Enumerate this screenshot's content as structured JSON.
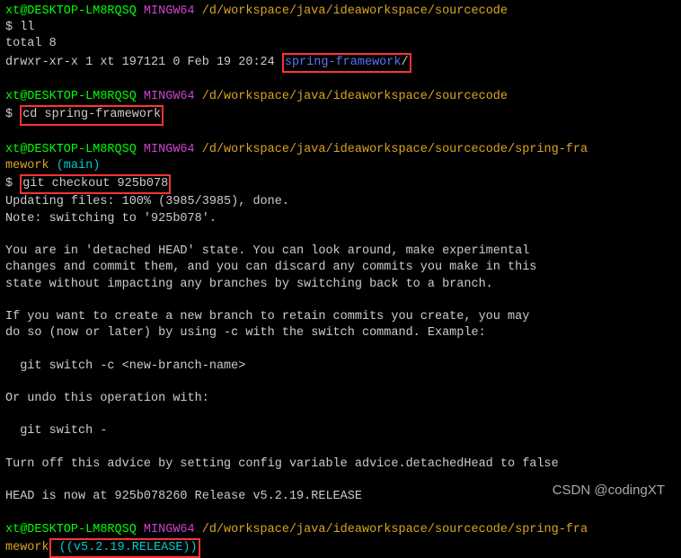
{
  "prompt1": {
    "user": "xt@DESKTOP-LM8RQSQ",
    "mingw": " MINGW64",
    "path": " /d/workspace/java/ideaworkspace/sourcecode"
  },
  "cmd1": "$ ll",
  "out1_l1": "total 8",
  "out1_l2_a": "drwxr-xr-x 1 xt 197121 0 Feb 19 20:24 ",
  "out1_l2_b": "spring-framework",
  "out1_l2_c": "/",
  "prompt2": {
    "user": "xt@DESKTOP-LM8RQSQ",
    "mingw": " MINGW64",
    "path": " /d/workspace/java/ideaworkspace/sourcecode"
  },
  "cmd2_prefix": "$ ",
  "cmd2": "cd spring-framework",
  "prompt3": {
    "user": "xt@DESKTOP-LM8RQSQ",
    "mingw": " MINGW64",
    "path": " /d/workspace/java/ideaworkspace/sourcecode/spring-fra",
    "path2": "mework",
    "branch": " (main)"
  },
  "cmd3_prefix": "$ ",
  "cmd3": "git checkout 925b078",
  "out3_l1": "Updating files: 100% (3985/3985), done.",
  "out3_l2": "Note: switching to '925b078'.",
  "out3_l3": "You are in 'detached HEAD' state. You can look around, make experimental",
  "out3_l4": "changes and commit them, and you can discard any commits you make in this",
  "out3_l5": "state without impacting any branches by switching back to a branch.",
  "out3_l6": "If you want to create a new branch to retain commits you create, you may",
  "out3_l7": "do so (now or later) by using -c with the switch command. Example:",
  "out3_l8": "  git switch -c <new-branch-name>",
  "out3_l9": "Or undo this operation with:",
  "out3_l10": "  git switch -",
  "out3_l11": "Turn off this advice by setting config variable advice.detachedHead to false",
  "out3_l12": "HEAD is now at 925b078260 Release v5.2.19.RELEASE",
  "prompt4": {
    "user": "xt@DESKTOP-LM8RQSQ",
    "mingw": " MINGW64",
    "path": " /d/workspace/java/ideaworkspace/sourcecode/spring-fra",
    "path2": "mework",
    "branch": " ((v5.2.19.RELEASE))"
  },
  "watermark": "CSDN @codingXT"
}
